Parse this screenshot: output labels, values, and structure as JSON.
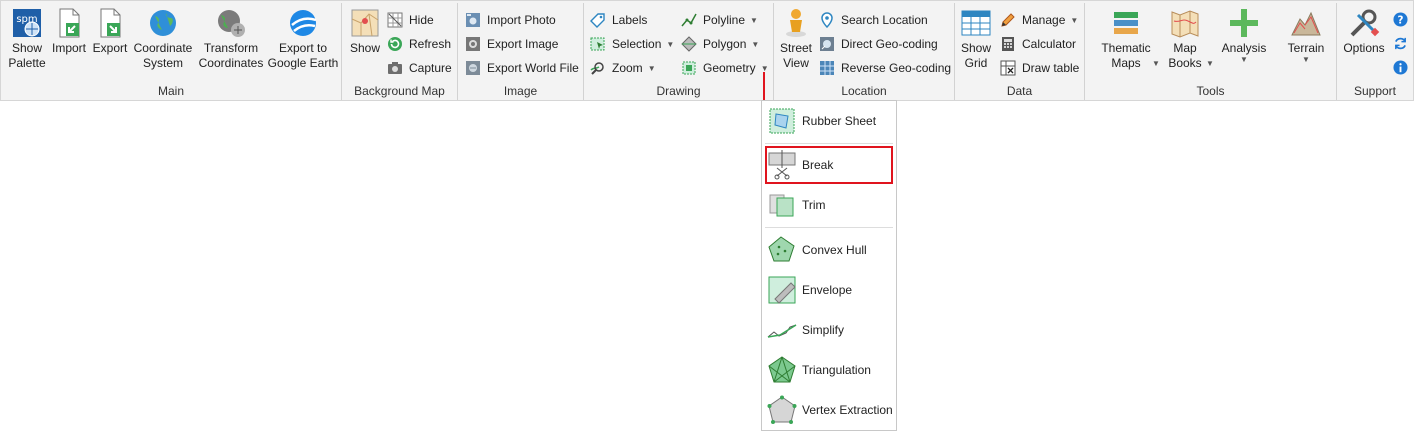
{
  "groups": {
    "main": "Main",
    "background_map": "Background Map",
    "image": "Image",
    "drawing": "Drawing",
    "location": "Location",
    "data": "Data",
    "tools": "Tools",
    "support": "Support"
  },
  "main": {
    "show_palette": [
      "Show",
      "Palette"
    ],
    "import": "Import",
    "export": "Export",
    "coordinate_system": [
      "Coordinate",
      "System"
    ],
    "transform_coordinates": [
      "Transform",
      "Coordinates"
    ],
    "export_google_earth": [
      "Export to",
      "Google Earth"
    ],
    "logo_text": "spm"
  },
  "background_map": {
    "show": "Show",
    "hide": "Hide",
    "refresh": "Refresh",
    "capture": "Capture"
  },
  "image": {
    "import_photo": "Import Photo",
    "export_image": "Export Image",
    "export_world_file": "Export World File"
  },
  "drawing": {
    "labels": "Labels",
    "selection": "Selection",
    "zoom": "Zoom",
    "polyline": "Polyline",
    "polygon": "Polygon",
    "geometry": "Geometry"
  },
  "location": {
    "street_view": [
      "Street",
      "View"
    ],
    "search_location": "Search Location",
    "direct_geocoding": "Direct Geo-coding",
    "reverse_geocoding": "Reverse Geo-coding"
  },
  "data": {
    "show_grid": [
      "Show",
      "Grid"
    ],
    "manage": "Manage",
    "calculator": "Calculator",
    "draw_table": "Draw table"
  },
  "tools": {
    "thematic_maps": [
      "Thematic",
      "Maps"
    ],
    "map_books": [
      "Map",
      "Books"
    ],
    "analysis": "Analysis",
    "terrain": "Terrain"
  },
  "support": {
    "options": "Options"
  },
  "geometry_menu": [
    "Rubber Sheet",
    "Break",
    "Trim",
    "Convex Hull",
    "Envelope",
    "Simplify",
    "Triangulation",
    "Vertex Extraction"
  ],
  "colors": {
    "accent": "#e0141e",
    "ribbon_bg": "#f3f3f3",
    "icon_green": "#3aa657",
    "icon_blue": "#1e88e5"
  }
}
